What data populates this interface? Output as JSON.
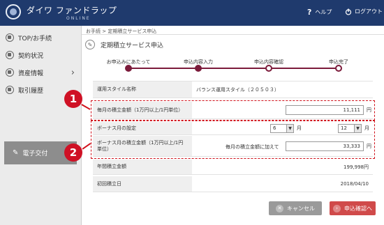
{
  "header": {
    "brand": "ダイワ ファンドラップ",
    "brand_sub": "ONLINE",
    "help_label": "ヘルプ",
    "logout_label": "ログアウト"
  },
  "sidebar": {
    "items": [
      {
        "label": "TOP/お手続"
      },
      {
        "label": "契約状況"
      },
      {
        "label": "資産情報"
      },
      {
        "label": "取引履歴"
      }
    ],
    "e_delivery_label": "電子交付"
  },
  "breadcrumb": "お手続 > 定期積立サービス申込",
  "page_title": "定期積立サービス申込",
  "steps": [
    {
      "label": "お申込みにあたって"
    },
    {
      "label": "申込内容入力"
    },
    {
      "label": "申込内容確認"
    },
    {
      "label": "申込完了"
    }
  ],
  "form": {
    "style_label": "運用スタイル名称",
    "style_value": "バランス運用スタイル（２０５０３）",
    "monthly_label": "毎月の積立金額（1万円以上/1円単位）",
    "monthly_value": "11,111",
    "yen": "円",
    "bonus_month_label": "ボーナス月の設定",
    "bonus_month_1": "6",
    "bonus_month_2": "12",
    "month_unit": "月",
    "bonus_amount_label": "ボーナス月の積立金額（1万円以上/1円単位）",
    "bonus_prefix": "毎月の積立金額に加えて",
    "bonus_amount_value": "33,333",
    "annual_label": "年間積立金額",
    "annual_value": "199,998円",
    "first_date_label": "初回積立日",
    "first_date_value": "2018/04/10"
  },
  "annotations": {
    "badge1": "1",
    "badge2": "2"
  },
  "buttons": {
    "cancel_label": "キャンセル",
    "confirm_label": "申込確認へ"
  },
  "colors": {
    "header": "#1f3a6d",
    "accent": "#7b1a3a",
    "annotation": "#cf1125",
    "confirm": "#d04a4a",
    "cancel": "#9a9a9a"
  }
}
